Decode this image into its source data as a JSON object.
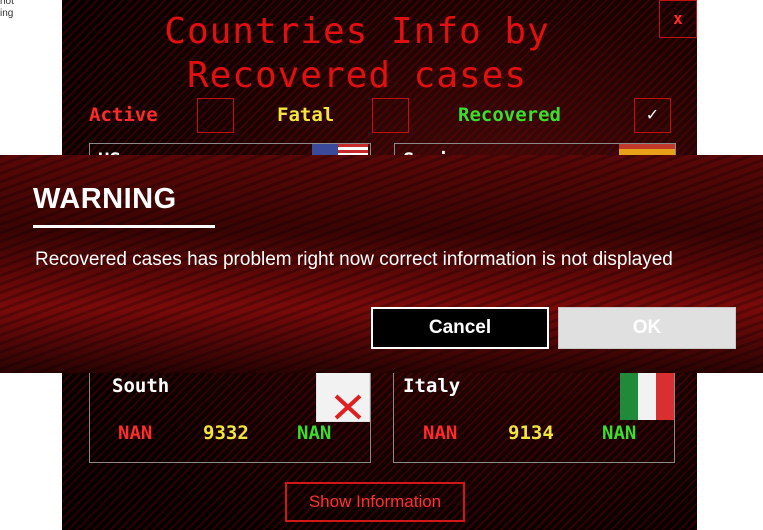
{
  "background": {
    "text_lines": [
      "not",
      "ing"
    ]
  },
  "app": {
    "title_line1": "Countries Info by",
    "title_line2": "Recovered cases",
    "close_label": "x",
    "filters": {
      "active_label": "Active",
      "fatal_label": "Fatal",
      "recovered_label": "Recovered",
      "recovered_check": "✓"
    },
    "cards_top": [
      {
        "name": "US",
        "flag_icon": "us-flag-icon"
      },
      {
        "name": "Spain",
        "flag_icon": "spain-flag-icon"
      }
    ],
    "cards_bottom": [
      {
        "name": "South",
        "flag_icon": "missing-image-icon",
        "active": "NAN",
        "fatal": "9332",
        "recovered": "NAN"
      },
      {
        "name": "Italy",
        "flag_icon": "italy-flag-icon",
        "active": "NAN",
        "fatal": "9134",
        "recovered": "NAN"
      }
    ],
    "show_button": "Show Information"
  },
  "dialog": {
    "title": "WARNING",
    "message": "Recovered cases has problem right now correct information is not displayed",
    "cancel_label": "Cancel",
    "ok_label": "OK"
  },
  "colors": {
    "active": "#ff2a2a",
    "fatal": "#f2e63a",
    "recovered": "#3adf2a",
    "title": "#e01010"
  }
}
